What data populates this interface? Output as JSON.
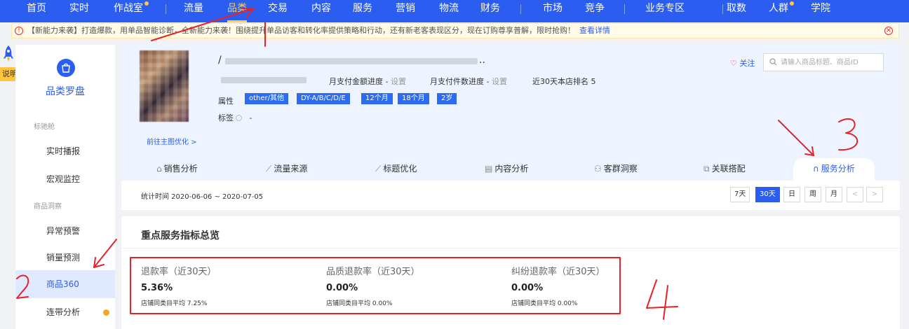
{
  "nav": {
    "items": [
      {
        "label": "首页"
      },
      {
        "label": "实时"
      },
      {
        "label": "作战室"
      },
      {
        "label": "流量"
      },
      {
        "label": "品类"
      },
      {
        "label": "交易"
      },
      {
        "label": "内容"
      },
      {
        "label": "服务"
      },
      {
        "label": "营销"
      },
      {
        "label": "物流"
      },
      {
        "label": "财务"
      },
      {
        "label": "市场"
      },
      {
        "label": "竞争"
      },
      {
        "label": "业务专区"
      },
      {
        "label": "取数"
      },
      {
        "label": "人群"
      },
      {
        "label": "学院"
      }
    ],
    "active": "品类"
  },
  "notice": {
    "text": "【新能力来袭】打造爆款，用单品智能诊断，全新能力来袭！围绕提升单品访客和转化率提供策略和行动，还有新老客表现区分，现在订购尊享普解，限时抢购！",
    "link": "查看详情"
  },
  "help_tab": "说明",
  "sidebar": {
    "title": "品类罗盘",
    "groups": [
      "标驰舱",
      "商品洞察"
    ],
    "items": [
      {
        "label": "实时播报"
      },
      {
        "label": "宏观监控"
      },
      {
        "label": "异常预警"
      },
      {
        "label": "销量预测"
      },
      {
        "label": "商品360"
      },
      {
        "label": "连带分析"
      }
    ],
    "active": "商品360"
  },
  "product": {
    "title_visible": "/",
    "title_tail": "..",
    "monthly_amount_label": "月支付金额进度 -",
    "monthly_amount_action": "设置",
    "monthly_count_label": "月支付件数进度 -",
    "monthly_count_action": "设置",
    "rank_text": "近30天本店排名 5",
    "attr_label": "属性",
    "tags": [
      "other/其他",
      "DY-A/B/C/D/E",
      "12个月",
      "18个月",
      "2岁"
    ],
    "tag_label": "标签",
    "tag_value": "-",
    "goto_link": "前往主图优化 >",
    "follow": "关注",
    "search_placeholder": "请输入商品标题、商品ID"
  },
  "tabs": [
    {
      "label": "销售分析",
      "icon": "cart-icon"
    },
    {
      "label": "流量来源",
      "icon": "line-chart-icon"
    },
    {
      "label": "标题优化",
      "icon": "line-chart-icon"
    },
    {
      "label": "内容分析",
      "icon": "content-icon"
    },
    {
      "label": "客群洞察",
      "icon": "users-icon"
    },
    {
      "label": "关联搭配",
      "icon": "link-icon"
    },
    {
      "label": "服务分析",
      "icon": "headset-icon"
    }
  ],
  "active_tab": "服务分析",
  "stat_time": "统计时间 2020-06-06 ~ 2020-07-05",
  "periods": [
    {
      "label": "7天"
    },
    {
      "label": "30天"
    },
    {
      "label": "日"
    },
    {
      "label": "周"
    },
    {
      "label": "月"
    },
    {
      "label": "<"
    },
    {
      "label": ">"
    }
  ],
  "active_period": "30天",
  "panel": {
    "title": "重点服务指标总览",
    "metrics": [
      {
        "label": "退款率（近30天）",
        "value": "5.36%",
        "avg": "店铺同类目平均 7.25%"
      },
      {
        "label": "品质退款率（近30天）",
        "value": "0.00%",
        "avg": "店铺同类目平均 0.00%"
      },
      {
        "label": "纠纷退款率（近30天）",
        "value": "0.00%",
        "avg": "店铺同类目平均 0.00%"
      }
    ]
  },
  "colors": {
    "primary": "#2b5df0",
    "nav_active": "#ffd33d",
    "annotation": "#e8202a"
  }
}
